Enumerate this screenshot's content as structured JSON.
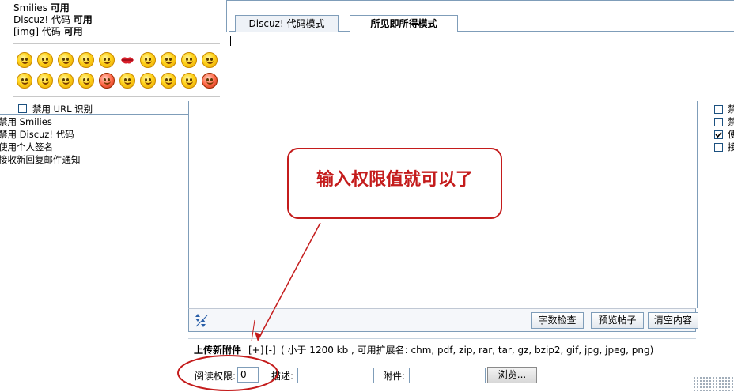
{
  "status": {
    "smilies": {
      "label": "Smilies ",
      "value": "可用"
    },
    "discuz_code": {
      "label": "Discuz! 代码 ",
      "value": "可用"
    },
    "img_code": {
      "label": "[img] 代码 ",
      "value": "可用"
    }
  },
  "smilies_icons": [
    "smile-icon",
    "grin-icon",
    "thumbs-up-icon",
    "victory-icon",
    "clock-icon",
    "lips-icon",
    "handshake-icon",
    "phone-icon",
    "happy-icon",
    "shy-icon",
    "tongue-icon",
    "confused-icon",
    "laugh-icon",
    "cry-icon",
    "angry-icon",
    "surprised-icon",
    "wink-icon",
    "cool-icon",
    "hungry-icon",
    "mad-icon"
  ],
  "options": {
    "disable_url": "禁用 URL 识别",
    "disable_smilies": "禁用 Smilies",
    "disable_discuz": "禁用 Discuz! 代码",
    "use_signature": "使用个人签名",
    "receive_notify": "接收新回复邮件通知"
  },
  "right_options": [
    {
      "checked": false,
      "label": "禁"
    },
    {
      "checked": false,
      "label": "禁"
    },
    {
      "checked": true,
      "label": "使"
    },
    {
      "checked": false,
      "label": "接"
    }
  ],
  "tabs": [
    {
      "label": "Discuz! 代码模式",
      "active": false
    },
    {
      "label": "所见即所得模式",
      "active": true
    }
  ],
  "toolbar": {
    "word_check": "字数检查",
    "preview": "预览帖子",
    "clear": "清空内容"
  },
  "upload": {
    "title": "上传新附件",
    "add": "[+]",
    "remove": "[-]",
    "info": "( 小于 1200 kb , 可用扩展名: chm, pdf, zip, rar, tar, gz, bzip2, gif, jpg, jpeg, png)",
    "read_perm_label": "阅读权限:",
    "read_perm_value": "0",
    "desc_label": "描述:",
    "attach_label": "附件:",
    "browse": "浏览..."
  },
  "annotation": {
    "text": "输入权限值就可以了"
  },
  "colors": {
    "annotation_red": "#c41c1c",
    "border": "#7f9db9"
  }
}
